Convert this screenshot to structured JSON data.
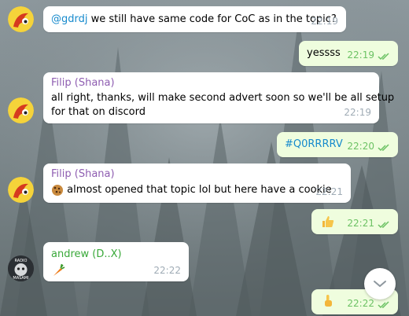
{
  "chat": {
    "messages": [
      {
        "id": "m1",
        "direction": "in",
        "text": "we still have same code for CoC as in the topic?",
        "mention": "@gdrdj",
        "time": "22:19"
      },
      {
        "id": "m2",
        "direction": "out",
        "text": "yessss",
        "time": "22:19"
      },
      {
        "id": "m3",
        "direction": "in",
        "sender": "Filip (Shana)",
        "text_line1": "all right, thanks, will make second advert soon so we'll be all setup",
        "text_line2": "for that on discord",
        "time": "22:19"
      },
      {
        "id": "m4",
        "direction": "out",
        "text": "#Q0RRRRV",
        "time": "22:20"
      },
      {
        "id": "m5",
        "direction": "in",
        "sender": "Filip (Shana)",
        "text": "almost opened that topic lol but here have a cookie",
        "emoji": "cookie",
        "time": "22:21"
      },
      {
        "id": "m6",
        "direction": "out",
        "emoji": "thumbs-up",
        "time": "22:21"
      },
      {
        "id": "m7",
        "direction": "in",
        "sender": "andrew (D..X)",
        "emoji": "carrot",
        "time": "22:22"
      },
      {
        "id": "m8",
        "direction": "out",
        "emoji": "pointing-up",
        "time": "22:22"
      }
    ]
  },
  "avatar_andrew": {
    "text_top": "RADIO",
    "text_bottom": "MASAMI"
  },
  "colors": {
    "outgoing_bubble": "#effdde",
    "incoming_bubble": "#ffffff",
    "sender_filip": "#8e5db1",
    "sender_andrew": "#3aa93a",
    "link": "#168acd",
    "time_out": "#6cc264",
    "time_in": "#a0acb6"
  },
  "icons": [
    "double-check-icon",
    "chevron-down-icon",
    "cookie-emoji",
    "thumbs-up-emoji",
    "carrot-emoji",
    "pointing-up-emoji"
  ]
}
